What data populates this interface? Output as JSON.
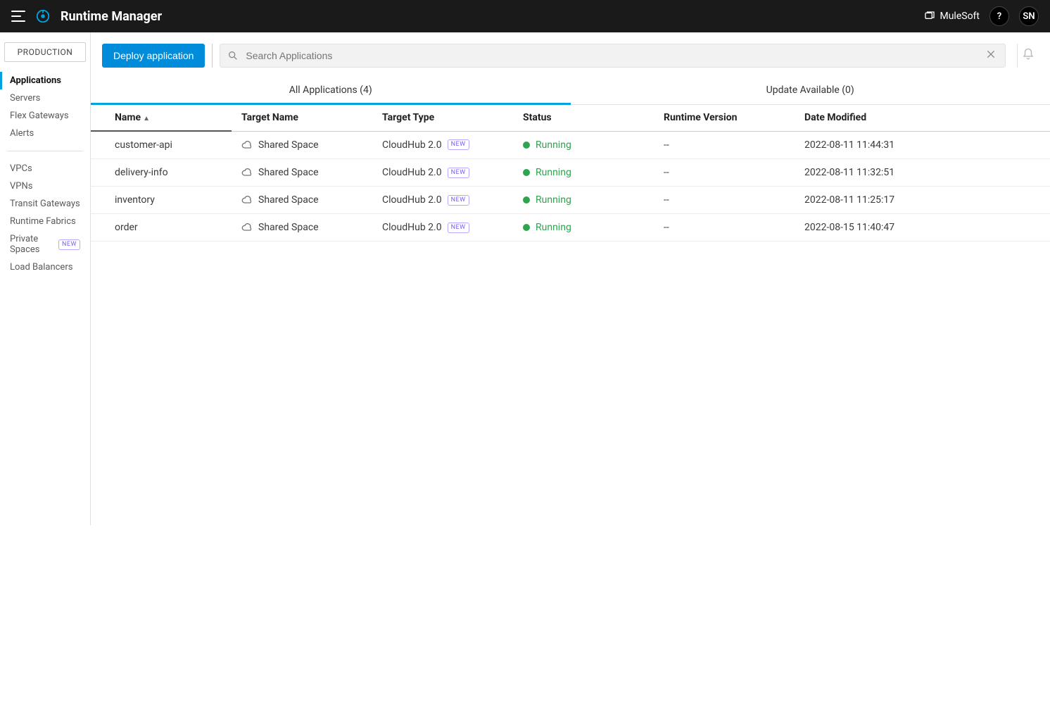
{
  "header": {
    "title": "Runtime Manager",
    "brand": "MuleSoft",
    "help": "?",
    "user_initials": "SN"
  },
  "sidebar": {
    "environment": "PRODUCTION",
    "group1": [
      {
        "label": "Applications",
        "active": true
      },
      {
        "label": "Servers"
      },
      {
        "label": "Flex Gateways"
      },
      {
        "label": "Alerts"
      }
    ],
    "group2": [
      {
        "label": "VPCs"
      },
      {
        "label": "VPNs"
      },
      {
        "label": "Transit Gateways"
      },
      {
        "label": "Runtime Fabrics"
      },
      {
        "label": "Private Spaces",
        "badge": "NEW"
      },
      {
        "label": "Load Balancers"
      }
    ]
  },
  "toolbar": {
    "deploy_label": "Deploy application",
    "search_placeholder": "Search Applications"
  },
  "tabs": {
    "all_label": "All Applications (4)",
    "update_label": "Update Available (0)"
  },
  "table": {
    "columns": {
      "name": "Name",
      "target_name": "Target Name",
      "target_type": "Target Type",
      "status": "Status",
      "runtime_version": "Runtime Version",
      "date_modified": "Date Modified"
    },
    "new_badge": "NEW",
    "rows": [
      {
        "name": "customer-api",
        "target_name": "Shared Space",
        "target_type": "CloudHub 2.0",
        "status": "Running",
        "runtime_version": "--",
        "date_modified": "2022-08-11 11:44:31"
      },
      {
        "name": "delivery-info",
        "target_name": "Shared Space",
        "target_type": "CloudHub 2.0",
        "status": "Running",
        "runtime_version": "--",
        "date_modified": "2022-08-11 11:32:51"
      },
      {
        "name": "inventory",
        "target_name": "Shared Space",
        "target_type": "CloudHub 2.0",
        "status": "Running",
        "runtime_version": "--",
        "date_modified": "2022-08-11 11:25:17"
      },
      {
        "name": "order",
        "target_name": "Shared Space",
        "target_type": "CloudHub 2.0",
        "status": "Running",
        "runtime_version": "--",
        "date_modified": "2022-08-15 11:40:47"
      }
    ]
  }
}
